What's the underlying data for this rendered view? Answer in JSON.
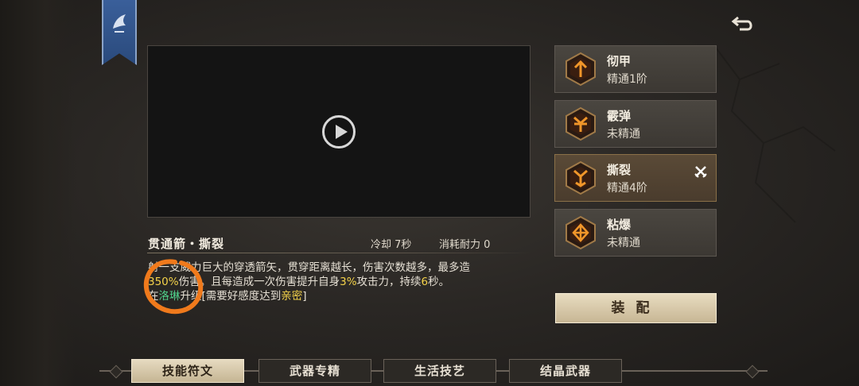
{
  "skill": {
    "title": "贯通箭・撕裂",
    "cooldown": "冷却 7秒",
    "stamina": "消耗耐力 0",
    "desc": {
      "l1": "射一支威力巨大的穿透箭矢，贯穿距离越长，伤害次数越多，最多造",
      "l2_dmg": "350%",
      "l2_a": "伤害。且每造成一次伤害提升自身",
      "l2_pct": "3%",
      "l2_b": "攻击力，持续",
      "l2_dur": "6",
      "l2_c": "秒。",
      "l3_pre": "在",
      "l3_npc": "洛琳",
      "l3_mid": "升级[需要好感度达到",
      "l3_req": "亲密",
      "l3_end": "]"
    }
  },
  "runes": [
    {
      "name": "彻甲",
      "level": "精通1阶",
      "icon": "arrow-up-rune-icon"
    },
    {
      "name": "霰弹",
      "level": "未精通",
      "icon": "spread-rune-icon"
    },
    {
      "name": "撕裂",
      "level": "精通4阶",
      "icon": "split-rune-icon",
      "selected": true
    },
    {
      "name": "粘爆",
      "level": "未精通",
      "icon": "diamond-rune-icon"
    }
  ],
  "equip_label": "装配",
  "tabs": [
    "技能符文",
    "武器专精",
    "生活技艺",
    "结晶武器"
  ],
  "active_tab": "技能符文",
  "colors": {
    "highlight_yellow": "#f4d24a",
    "highlight_green": "#4fd08a",
    "annotation_orange": "#f07a1c"
  }
}
